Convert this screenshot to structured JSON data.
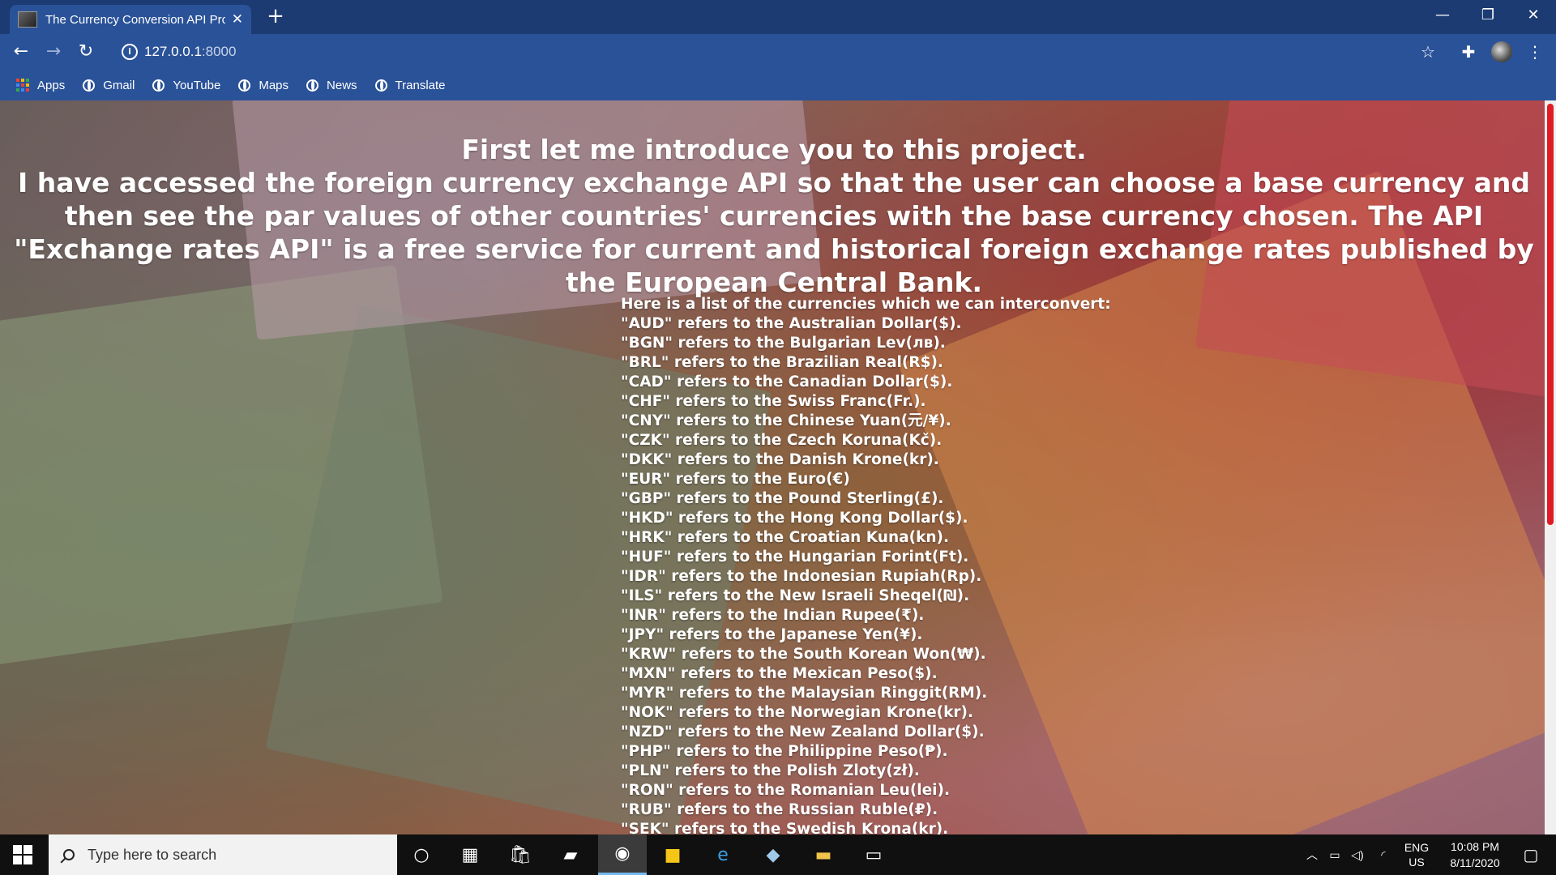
{
  "browser": {
    "tab_title": "The Currency Conversion API Pro",
    "url_host": "127.0.0.1",
    "url_port": ":8000",
    "bookmarks": [
      "Apps",
      "Gmail",
      "YouTube",
      "Maps",
      "News",
      "Translate"
    ]
  },
  "page": {
    "intro_line1": "First let me introduce you to this project.",
    "intro_line2": "I have accessed the foreign currency exchange API so that the user can choose a base currency and then see the par values of other countries' currencies with the base currency chosen. The API \"Exchange rates API\" is a free service for current and historical foreign exchange rates published by the European Central Bank.",
    "list_heading": "Here is a list of the currencies which we can interconvert:",
    "currencies": [
      "\"AUD\" refers to the Australian Dollar($).",
      "\"BGN\" refers to the Bulgarian Lev(лв).",
      "\"BRL\" refers to the Brazilian Real(R$).",
      "\"CAD\" refers to the Canadian Dollar($).",
      "\"CHF\" refers to the Swiss Franc(Fr.).",
      "\"CNY\" refers to the Chinese Yuan(元/¥).",
      "\"CZK\" refers to the Czech Koruna(Kč).",
      "\"DKK\" refers to the Danish Krone(kr).",
      "\"EUR\" refers to the Euro(€)",
      "\"GBP\" refers to the Pound Sterling(£).",
      "\"HKD\" refers to the Hong Kong Dollar($).",
      "\"HRK\" refers to the Croatian Kuna(kn).",
      "\"HUF\" refers to the Hungarian Forint(Ft).",
      "\"IDR\" refers to the Indonesian Rupiah(Rp).",
      "\"ILS\" refers to the New Israeli Sheqel(₪).",
      "\"INR\" refers to the Indian Rupee(₹).",
      "\"JPY\" refers to the Japanese Yen(¥).",
      "\"KRW\" refers to the South Korean Won(₩).",
      "\"MXN\" refers to the Mexican Peso($).",
      "\"MYR\" refers to the Malaysian Ringgit(RM).",
      "\"NOK\" refers to the Norwegian Krone(kr).",
      "\"NZD\" refers to the New Zealand Dollar($).",
      "\"PHP\" refers to the Philippine Peso(₱).",
      "\"PLN\" refers to the Polish Zloty(zł).",
      "\"RON\" refers to the Romanian Leu(lei).",
      "\"RUB\" refers to the Russian Ruble(₽).",
      "\"SEK\" refers to the Swedish Krona(kr)."
    ]
  },
  "taskbar": {
    "search_placeholder": "Type here to search",
    "lang_line1": "ENG",
    "lang_line2": "US",
    "time": "10:08 PM",
    "date": "8/11/2020"
  },
  "colors": {
    "chrome_dark": "#1c3b73",
    "chrome": "#2a5298",
    "scroll_thumb": "#e01b24"
  }
}
